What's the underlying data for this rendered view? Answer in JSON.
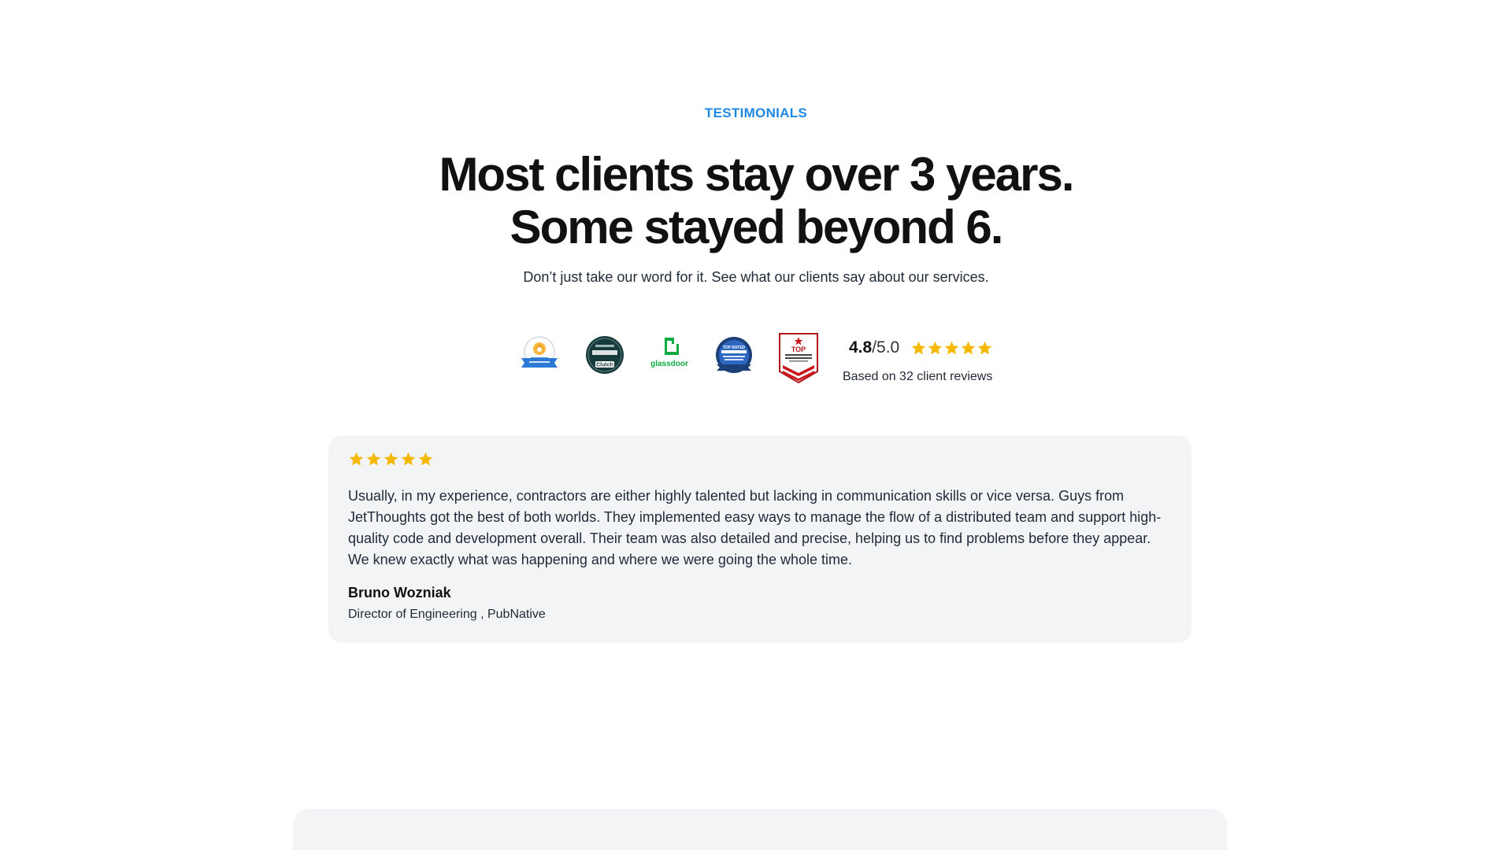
{
  "section": {
    "eyebrow": "TESTIMONIALS",
    "headline_line1": "Most clients stay over 3 years.",
    "headline_line2": "Some stayed beyond 6.",
    "subhead": "Don’t just take our word for it. See what our clients say about our services."
  },
  "badges": [
    {
      "name": "goodfirms-badge"
    },
    {
      "name": "clutch-badge",
      "text": "Clutch"
    },
    {
      "name": "glassdoor-badge",
      "text": "glassdoor"
    },
    {
      "name": "top-rated-badge",
      "text": "TOP RATED"
    },
    {
      "name": "top-web-dev-badge",
      "text": "TOP"
    }
  ],
  "rating": {
    "value": "4.8",
    "max": "/5.0",
    "stars": 5,
    "reviews_text": "Based on 32 client reviews"
  },
  "testimonial": {
    "stars": 5,
    "quote": "Usually, in my experience, contractors are either highly talented but lacking in communication skills or vice versa. Guys from JetThoughts got the best of both worlds. They implemented easy ways to manage the flow of a distributed team and support high-quality code and development overall. Their team was also detailed and precise, helping us to find problems before they appear. We knew exactly what was happening and where we were going the whole time.",
    "author": "Bruno Wozniak",
    "role": "Director of Engineering , PubNative"
  },
  "colors": {
    "accent": "#1e88e5",
    "star": "#f5b800",
    "card_bg": "#f3f4f6"
  }
}
